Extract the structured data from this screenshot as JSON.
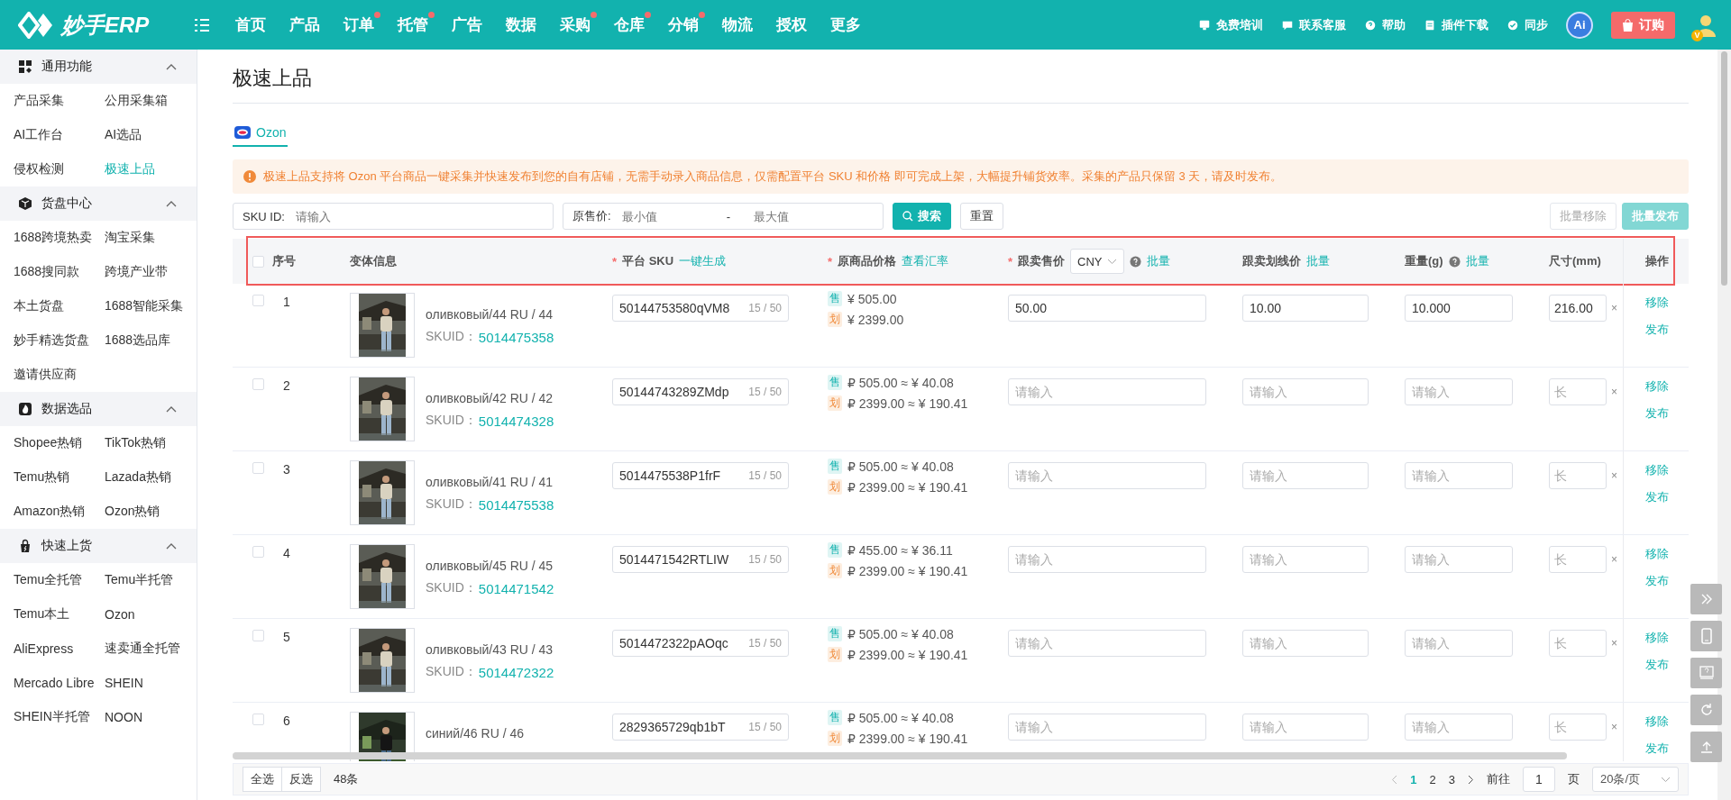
{
  "topbar": {
    "logo": "妙手ERP",
    "nav": [
      {
        "label": "首页",
        "badge": false
      },
      {
        "label": "产品",
        "badge": false
      },
      {
        "label": "订单",
        "badge": true
      },
      {
        "label": "托管",
        "badge": true
      },
      {
        "label": "广告",
        "badge": false
      },
      {
        "label": "数据",
        "badge": false
      },
      {
        "label": "采购",
        "badge": true
      },
      {
        "label": "仓库",
        "badge": true
      },
      {
        "label": "分销",
        "badge": true
      },
      {
        "label": "物流",
        "badge": false
      },
      {
        "label": "授权",
        "badge": false
      },
      {
        "label": "更多",
        "badge": false
      }
    ],
    "links": [
      {
        "label": "免费培训",
        "kind": "monitor"
      },
      {
        "label": "联系客服",
        "kind": "chat"
      },
      {
        "label": "帮助",
        "kind": "help"
      },
      {
        "label": "插件下载",
        "kind": "doc"
      },
      {
        "label": "同步",
        "kind": "sync"
      }
    ],
    "ai_badge": "Ai",
    "order_button": "订购",
    "vip_badge": "V"
  },
  "sidebar": {
    "sections": [
      {
        "title": "通用功能",
        "kind": "grid",
        "expanded": true,
        "items": [
          {
            "label": "产品采集",
            "selected": false
          },
          {
            "label": "公用采集箱",
            "selected": false
          },
          {
            "label": "AI工作台",
            "selected": false
          },
          {
            "label": "AI选品",
            "selected": false
          },
          {
            "label": "侵权检测",
            "selected": false
          },
          {
            "label": "极速上品",
            "selected": true
          }
        ]
      },
      {
        "title": "货盘中心",
        "kind": "cube",
        "expanded": true,
        "items": [
          {
            "label": "1688跨境热卖",
            "selected": false
          },
          {
            "label": "淘宝采集",
            "selected": false
          },
          {
            "label": "1688搜同款",
            "selected": false
          },
          {
            "label": "跨境产业带",
            "selected": false
          },
          {
            "label": "本土货盘",
            "selected": false
          },
          {
            "label": "1688智能采集",
            "selected": false
          },
          {
            "label": "妙手精选货盘",
            "selected": false
          },
          {
            "label": "1688选品库",
            "selected": false
          },
          {
            "label": "邀请供应商",
            "selected": false
          }
        ]
      },
      {
        "title": "数据选品",
        "kind": "fire",
        "expanded": true,
        "items": [
          {
            "label": "Shopee热销",
            "selected": false
          },
          {
            "label": "TikTok热销",
            "selected": false
          },
          {
            "label": "Temu热销",
            "selected": false
          },
          {
            "label": "Lazada热销",
            "selected": false
          },
          {
            "label": "Amazon热销",
            "selected": false
          },
          {
            "label": "Ozon热销",
            "selected": false
          }
        ]
      },
      {
        "title": "快速上货",
        "kind": "bag",
        "expanded": true,
        "items": [
          {
            "label": "Temu全托管",
            "selected": false
          },
          {
            "label": "Temu半托管",
            "selected": false
          },
          {
            "label": "Temu本土",
            "selected": false
          },
          {
            "label": "Ozon",
            "selected": false
          },
          {
            "label": "AliExpress",
            "selected": false
          },
          {
            "label": "速卖通全托管",
            "selected": false
          },
          {
            "label": "Mercado Libre",
            "selected": false
          },
          {
            "label": "SHEIN",
            "selected": false
          },
          {
            "label": "SHEIN半托管",
            "selected": false
          },
          {
            "label": "NOON",
            "selected": false
          }
        ]
      }
    ]
  },
  "page": {
    "title": "极速上品",
    "tabs": [
      {
        "label": "Ozon",
        "selected": true
      }
    ],
    "notice": "极速上品支持将 Ozon 平台商品一键采集并快速发布到您的自有店铺，无需手动录入商品信息，仅需配置平台 SKU 和价格 即可完成上架，大幅提升铺货效率。采集的产品只保留 3 天，请及时发布。"
  },
  "filters": {
    "sku": {
      "label": "SKU ID:",
      "placeholder": "请输入"
    },
    "price": {
      "label": "原售价:",
      "min_placeholder": "最小值",
      "separator": "-",
      "max_placeholder": "最大值"
    },
    "search_button": "搜索",
    "reset_button": "重置",
    "batch_buttons": [
      {
        "label": "批量移除",
        "kind": "plain",
        "disabled": true
      },
      {
        "label": "批量发布",
        "kind": "primary",
        "disabled": true
      }
    ]
  },
  "table": {
    "highlighted": true,
    "header_checked": false,
    "columns": [
      {
        "label": "序号"
      },
      {
        "label": "变体信息"
      },
      {
        "required_mark": "*",
        "label": "平台 SKU",
        "link": "一键生成"
      },
      {
        "required_mark": "*",
        "label": "原商品价格",
        "link": "查看汇率"
      },
      {
        "required_mark": "*",
        "label": "跟卖售价",
        "select": "CNY",
        "help": true,
        "link": "批量"
      },
      {
        "label": "跟卖划线价",
        "link": "批量"
      },
      {
        "label": "重量(g)",
        "help": true,
        "link": "批量"
      },
      {
        "label": "尺寸(mm)"
      },
      {
        "label": "操作"
      }
    ],
    "rows": [
      {
        "checked": false,
        "seq": "1",
        "kind": "picture",
        "variant": "оливковый/44 RU / 44",
        "skuid_label": "SKUID：",
        "skuid": "5014475358",
        "sku": "50144753580qVM8",
        "sku_count": "15 / 50",
        "sale_tag": "售",
        "sale_price": "¥ 505.00",
        "strike_tag": "划",
        "strike_price": "¥ 2399.00",
        "follow_price": {
          "value": "50.00"
        },
        "follow_strike": {
          "value": "10.00"
        },
        "weight": {
          "value": "10.000"
        },
        "size": {
          "value": "216.00"
        },
        "size_sep": "×",
        "actions": [
          "移除",
          "发布"
        ]
      },
      {
        "checked": false,
        "seq": "2",
        "kind": "picture",
        "variant": "оливковый/42 RU / 42",
        "skuid_label": "SKUID：",
        "skuid": "5014474328",
        "sku": "50144743289ZMdp",
        "sku_count": "15 / 50",
        "sale_tag": "售",
        "sale_price": "₽ 505.00 ≈ ¥ 40.08",
        "strike_tag": "划",
        "strike_price": "₽ 2399.00 ≈ ¥ 190.41",
        "follow_price": {
          "placeholder": "请输入"
        },
        "follow_strike": {
          "placeholder": "请输入"
        },
        "weight": {
          "placeholder": "请输入"
        },
        "size": {
          "placeholder": "长"
        },
        "size_sep": "×",
        "actions": [
          "移除",
          "发布"
        ]
      },
      {
        "checked": false,
        "seq": "3",
        "kind": "picture",
        "variant": "оливковый/41 RU / 41",
        "skuid_label": "SKUID：",
        "skuid": "5014475538",
        "sku": "5014475538P1frF",
        "sku_count": "15 / 50",
        "sale_tag": "售",
        "sale_price": "₽ 505.00 ≈ ¥ 40.08",
        "strike_tag": "划",
        "strike_price": "₽ 2399.00 ≈ ¥ 190.41",
        "follow_price": {
          "placeholder": "请输入"
        },
        "follow_strike": {
          "placeholder": "请输入"
        },
        "weight": {
          "placeholder": "请输入"
        },
        "size": {
          "placeholder": "长"
        },
        "size_sep": "×",
        "actions": [
          "移除",
          "发布"
        ]
      },
      {
        "checked": false,
        "seq": "4",
        "kind": "picture",
        "variant": "оливковый/45 RU / 45",
        "skuid_label": "SKUID：",
        "skuid": "5014471542",
        "sku": "5014471542RTLIW",
        "sku_count": "15 / 50",
        "sale_tag": "售",
        "sale_price": "₽ 455.00 ≈ ¥ 36.11",
        "strike_tag": "划",
        "strike_price": "₽ 2399.00 ≈ ¥ 190.41",
        "follow_price": {
          "placeholder": "请输入"
        },
        "follow_strike": {
          "placeholder": "请输入"
        },
        "weight": {
          "placeholder": "请输入"
        },
        "size": {
          "placeholder": "长"
        },
        "size_sep": "×",
        "actions": [
          "移除",
          "发布"
        ]
      },
      {
        "checked": false,
        "seq": "5",
        "kind": "picture",
        "variant": "оливковый/43 RU / 43",
        "skuid_label": "SKUID：",
        "skuid": "5014472322",
        "sku": "5014472322pAOqc",
        "sku_count": "15 / 50",
        "sale_tag": "售",
        "sale_price": "₽ 505.00 ≈ ¥ 40.08",
        "strike_tag": "划",
        "strike_price": "₽ 2399.00 ≈ ¥ 190.41",
        "follow_price": {
          "placeholder": "请输入"
        },
        "follow_strike": {
          "placeholder": "请输入"
        },
        "weight": {
          "placeholder": "请输入"
        },
        "size": {
          "placeholder": "长"
        },
        "size_sep": "×",
        "actions": [
          "移除",
          "发布"
        ]
      },
      {
        "checked": false,
        "seq": "6",
        "kind": "picture",
        "variant": "синий/46 RU / 46",
        "sku": "2829365729qb1bT",
        "sku_count": "15 / 50",
        "sale_tag": "售",
        "sale_price": "₽ 505.00 ≈ ¥ 40.08",
        "strike_tag": "划",
        "strike_price": "₽ 2399.00 ≈ ¥ 190.41",
        "follow_price": {
          "placeholder": "请输入"
        },
        "follow_strike": {
          "placeholder": "请输入"
        },
        "weight": {
          "placeholder": "请输入"
        },
        "size": {
          "placeholder": "长"
        },
        "size_sep": "×",
        "actions": [
          "移除",
          "发布"
        ]
      }
    ]
  },
  "footer": {
    "select_all": "全选",
    "invert": "反选",
    "total": "48条",
    "pages": [
      {
        "label": "1",
        "selected": true
      },
      {
        "label": "2",
        "selected": false
      },
      {
        "label": "3",
        "selected": false
      }
    ],
    "goto_label": "前往",
    "goto_value": "1",
    "page_unit": "页",
    "page_size": "20条/页"
  }
}
